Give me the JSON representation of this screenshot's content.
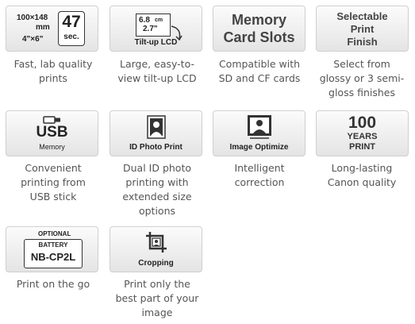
{
  "features": [
    {
      "icon": {
        "name": "print-size-icon",
        "lines": [
          "100×148",
          "mm",
          "4\"×6\"",
          "47",
          "sec."
        ]
      },
      "caption": [
        "Fast, lab quality",
        "prints"
      ]
    },
    {
      "icon": {
        "name": "tilt-lcd-icon",
        "lines": [
          "6.8",
          "cm",
          "2.7\"",
          "Tilt-up LCD"
        ]
      },
      "caption": [
        "Large, easy-to-",
        "view tilt-up LCD"
      ]
    },
    {
      "icon": {
        "name": "memory-card-slots-icon",
        "lines": [
          "Memory",
          "Card Slots"
        ]
      },
      "caption": [
        "Compatible with",
        "SD and CF cards"
      ]
    },
    {
      "icon": {
        "name": "print-finish-icon",
        "lines": [
          "Selectable",
          "Print",
          "Finish"
        ]
      },
      "caption": [
        "Select from",
        "glossy or 3 semi-",
        "gloss finishes"
      ]
    },
    {
      "icon": {
        "name": "usb-memory-icon",
        "lines": [
          "USB",
          "Memory"
        ]
      },
      "caption": [
        "Convenient",
        "printing from",
        "USB stick"
      ]
    },
    {
      "icon": {
        "name": "id-photo-print-icon",
        "lines": [
          "ID Photo Print"
        ]
      },
      "caption": [
        "Dual ID photo",
        "printing with",
        "extended size",
        "options"
      ]
    },
    {
      "icon": {
        "name": "image-optimize-icon",
        "lines": [
          "Image Optimize"
        ]
      },
      "caption": [
        "Intelligent",
        "correction"
      ]
    },
    {
      "icon": {
        "name": "100-years-print-icon",
        "lines": [
          "100",
          "YEARS",
          "PRINT"
        ]
      },
      "caption": [
        "Long-lasting",
        "Canon quality"
      ]
    },
    {
      "icon": {
        "name": "battery-icon",
        "lines": [
          "OPTIONAL",
          "BATTERY",
          "NB-CP2L"
        ]
      },
      "caption": [
        "Print on the go"
      ]
    },
    {
      "icon": {
        "name": "cropping-icon",
        "lines": [
          "Cropping"
        ]
      },
      "caption": [
        "Print only the",
        "best part of your",
        "image"
      ]
    }
  ]
}
